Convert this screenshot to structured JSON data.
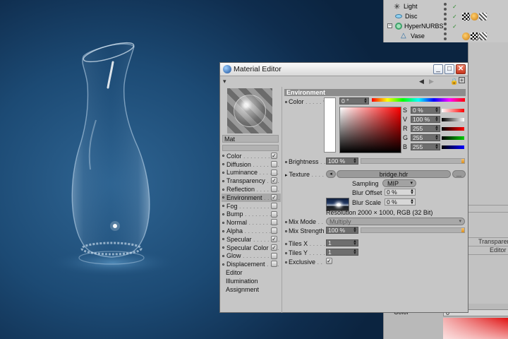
{
  "object_manager": {
    "objects": [
      {
        "name": "Light",
        "icon": "light-icon"
      },
      {
        "name": "Disc",
        "icon": "disc-icon"
      },
      {
        "name": "HyperNURBS",
        "icon": "hypernurbs-icon"
      },
      {
        "name": "Vase",
        "icon": "lathe-icon"
      }
    ],
    "check": "✓"
  },
  "attributes_strip": {
    "col1": "Transparen",
    "col2": "Editor"
  },
  "bottom_panel": {
    "color_label": "Color",
    "value": "0"
  },
  "material_editor": {
    "title": "Material Editor",
    "window_buttons": {
      "minimize": "_",
      "maximize": "□",
      "close": "✕"
    },
    "material_name": "Mat",
    "channels": [
      {
        "label": "Color",
        "checked": true
      },
      {
        "label": "Diffusion",
        "checked": false
      },
      {
        "label": "Luminance",
        "checked": false
      },
      {
        "label": "Transparency",
        "checked": true
      },
      {
        "label": "Reflection",
        "checked": false
      },
      {
        "label": "Environment",
        "checked": true,
        "selected": true
      },
      {
        "label": "Fog",
        "checked": false
      },
      {
        "label": "Bump",
        "checked": false
      },
      {
        "label": "Normal",
        "checked": false
      },
      {
        "label": "Alpha",
        "checked": false
      },
      {
        "label": "Specular",
        "checked": true
      },
      {
        "label": "Specular Color",
        "checked": true
      },
      {
        "label": "Glow",
        "checked": false
      },
      {
        "label": "Displacement",
        "checked": false
      }
    ],
    "extra_items": [
      "Editor",
      "Illumination",
      "Assignment"
    ],
    "check_glyph": "✓",
    "section_title": "Environment",
    "color": {
      "label": "Color",
      "hue_value": "0 °",
      "sliders": [
        {
          "letter": "S",
          "value": "0 %"
        },
        {
          "letter": "V",
          "value": "100 %"
        },
        {
          "letter": "R",
          "value": "255"
        },
        {
          "letter": "G",
          "value": "255"
        },
        {
          "letter": "B",
          "value": "255"
        }
      ]
    },
    "brightness": {
      "label": "Brightness",
      "value": "100 %",
      "level": 1.0
    },
    "texture": {
      "label": "Texture",
      "file": "bridge.hdr",
      "more_button": "...",
      "sampling_label": "Sampling",
      "sampling_value": "MIP",
      "blur_offset_label": "Blur Offset",
      "blur_offset_value": "0 %",
      "blur_scale_label": "Blur Scale",
      "blur_scale_value": "0 %",
      "resolution": "Resolution 2000 × 1000, RGB (32 Bit)"
    },
    "mix_mode": {
      "label": "Mix Mode",
      "value": "Multiply"
    },
    "mix_strength": {
      "label": "Mix Strength",
      "value": "100 %",
      "level": 1.0
    },
    "tiles_x": {
      "label": "Tiles X",
      "value": "1"
    },
    "tiles_y": {
      "label": "Tiles Y",
      "value": "1"
    },
    "exclusive": {
      "label": "Exclusive",
      "checked": true
    }
  },
  "colors": {
    "viewport_bg": "#1c4a74",
    "panel_bg": "#c6c6c6",
    "accent_orange": "#d88f20"
  }
}
